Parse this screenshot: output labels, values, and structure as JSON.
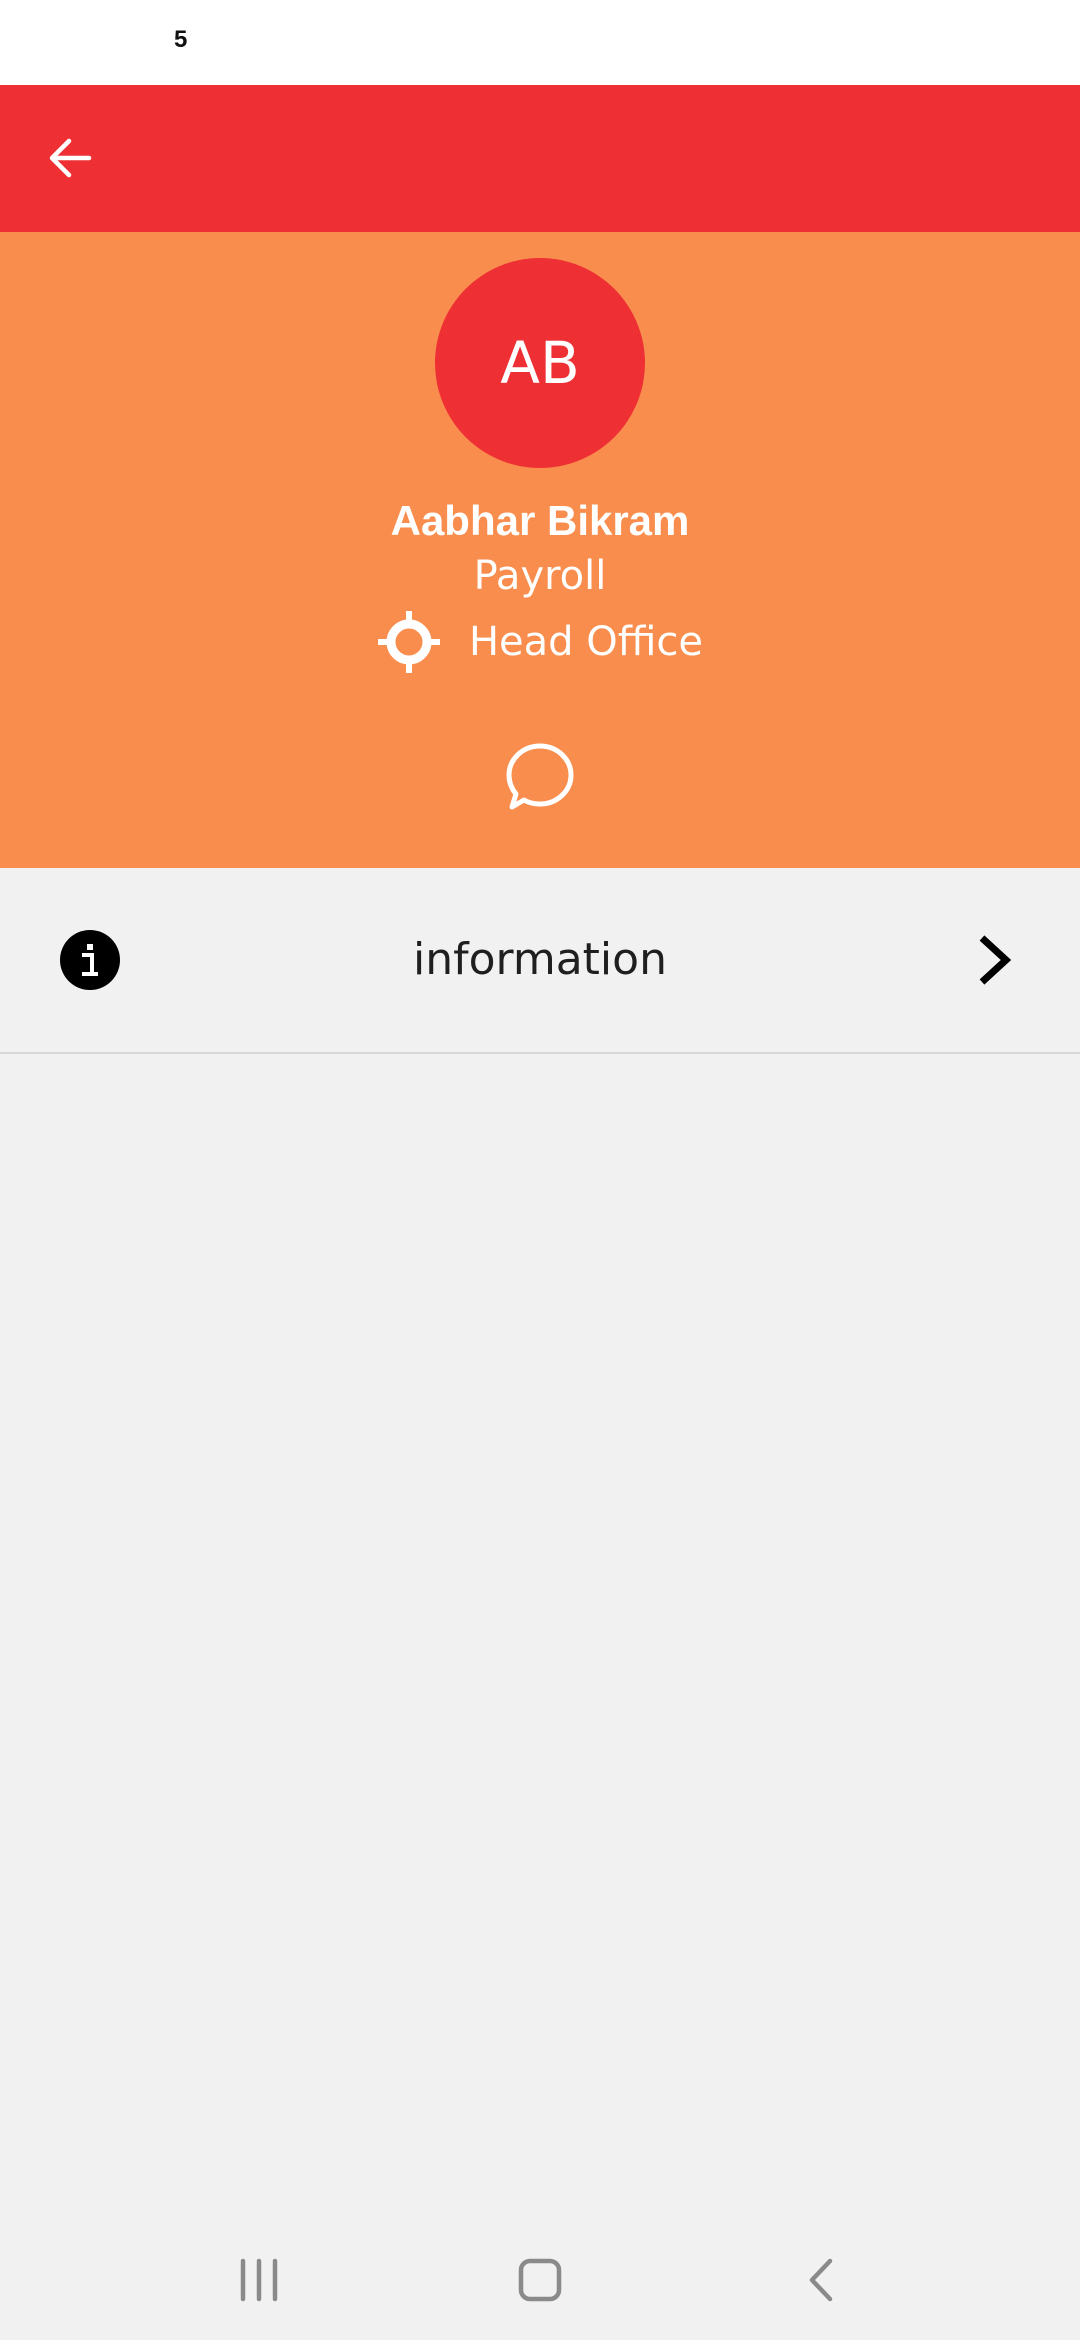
{
  "status_bar": {
    "text": "5"
  },
  "app_bar": {
    "background_color": "#ee3034",
    "back_icon": "arrow-left-icon"
  },
  "profile": {
    "background_color": "#f98d4d",
    "avatar_color": "#ee3034",
    "initials": "AB",
    "name": "Aabhar Bikram",
    "department": "Payroll",
    "location_icon": "crosshair-icon",
    "location": "Head Office",
    "chat_icon": "chat-bubble-icon"
  },
  "info_row": {
    "icon": "info-icon",
    "label": "information",
    "chevron_icon": "chevron-right-icon"
  },
  "nav_bar": {
    "recents_icon": "recents-icon",
    "home_icon": "home-icon",
    "back_icon": "back-chevron-icon"
  }
}
